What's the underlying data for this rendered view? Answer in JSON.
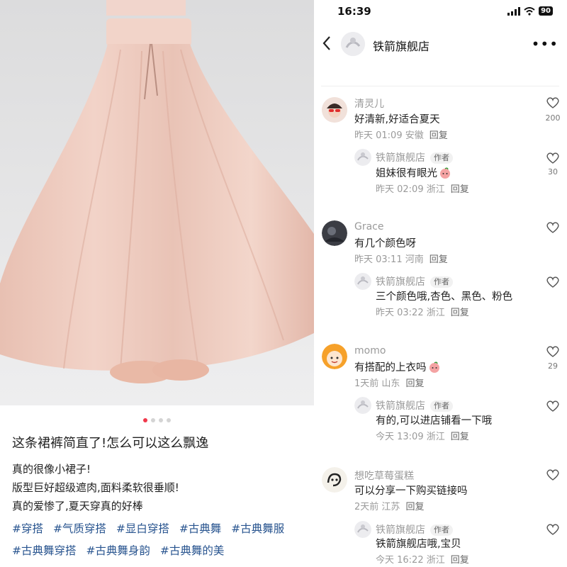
{
  "status_bar": {
    "time": "16:39",
    "battery": "90"
  },
  "nav": {
    "store_name": "铁箭旗舰店",
    "back_icon": "chevron-left-icon",
    "more_icon": "more-dots-icon"
  },
  "post": {
    "title": "这条裙裤简直了!怎么可以这么飘逸",
    "lines": [
      "真的很像小裙子!",
      "版型巨好超级遮肉,面料柔软很垂顺!",
      "真的爱惨了,夏天穿真的好棒"
    ],
    "tags": [
      "#穿搭",
      "#气质穿搭",
      "#显白穿搭",
      "#古典舞",
      "#古典舞服",
      "#古典舞穿搭",
      "#古典舞身韵",
      "#古典舞的美"
    ],
    "carousel": {
      "total": 4,
      "active": 1
    }
  },
  "comments": [
    {
      "user": "清灵儿",
      "text": "好清新,好适合夏天",
      "time": "昨天 01:09",
      "location": "安徽",
      "reply_label": "回复",
      "likes": "200",
      "reply": {
        "user": "铁箭旗舰店",
        "author_label": "作者",
        "text": "姐妹很有眼光",
        "time": "昨天 02:09",
        "location": "浙江",
        "reply_label": "回复",
        "likes": "30"
      }
    },
    {
      "user": "Grace",
      "text": "有几个颜色呀",
      "time": "昨天 03:11",
      "location": "河南",
      "reply_label": "回复",
      "likes": "",
      "reply": {
        "user": "铁箭旗舰店",
        "author_label": "作者",
        "text": "三个颜色哦,杏色、黑色、粉色",
        "time": "昨天 03:22",
        "location": "浙江",
        "reply_label": "回复",
        "likes": ""
      }
    },
    {
      "user": "momo",
      "text": "有搭配的上衣吗",
      "time": "1天前",
      "location": "山东",
      "reply_label": "回复",
      "likes": "29",
      "reply": {
        "user": "铁箭旗舰店",
        "author_label": "作者",
        "text": "有的,可以进店铺看一下哦",
        "time": "今天 13:09",
        "location": "浙江",
        "reply_label": "回复",
        "likes": ""
      }
    },
    {
      "user": "想吃草莓蛋糕",
      "text": "可以分享一下购买链接吗",
      "time": "2天前",
      "location": "江苏",
      "reply_label": "回复",
      "likes": "",
      "reply": {
        "user": "铁箭旗舰店",
        "author_label": "作者",
        "text": "铁箭旗舰店哦,宝贝",
        "time": "今天 16:22",
        "location": "浙江",
        "reply_label": "回复",
        "likes": ""
      }
    }
  ],
  "colors": {
    "accent": "#f0384b",
    "tag": "#28548f",
    "meta": "#9a9a9a"
  }
}
